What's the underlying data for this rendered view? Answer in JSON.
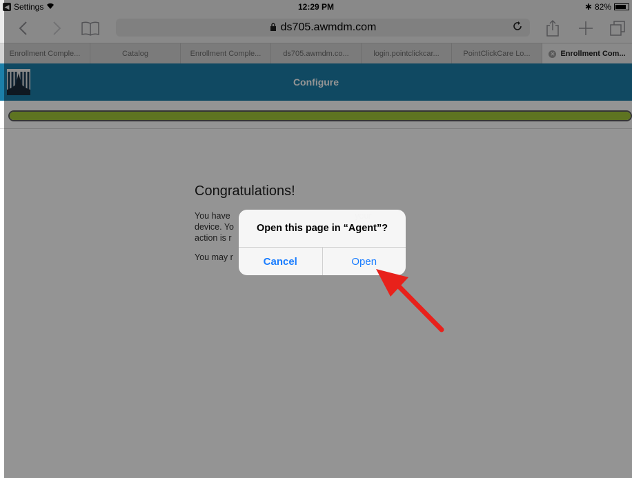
{
  "status_bar": {
    "back_app": "Settings",
    "time": "12:29 PM",
    "bluetooth": "✱",
    "battery_percent": "82%",
    "battery_level": 0.82
  },
  "toolbar": {
    "url": "ds705.awmdm.com"
  },
  "tabs": [
    {
      "label": "Enrollment Comple..."
    },
    {
      "label": "Catalog"
    },
    {
      "label": "Enrollment Comple..."
    },
    {
      "label": "ds705.awmdm.co..."
    },
    {
      "label": "login.pointclickcar..."
    },
    {
      "label": "PointClickCare Lo..."
    },
    {
      "label": "Enrollment Com...",
      "active": true
    }
  ],
  "page": {
    "title": "Configure",
    "progress": 1.0,
    "heading": "Congratulations!",
    "paragraph1": "You have                                                    your\ndevice. Yo                                                 urther\naction is r",
    "paragraph2": "You may r"
  },
  "alert": {
    "message": "Open this page in “Agent”?",
    "cancel_label": "Cancel",
    "open_label": "Open"
  },
  "colors": {
    "header_blue": "#1c7fa9",
    "progress_green": "#a3c93a",
    "ios_blue": "#1a7dff",
    "arrow_red": "#e8211b"
  },
  "icons": {
    "back": "chevron-left-icon",
    "forward": "chevron-right-icon",
    "bookmarks": "book-icon",
    "share": "share-icon",
    "new_tab": "plus-icon",
    "tabs": "tabs-icon",
    "reload": "reload-icon",
    "lock": "lock-icon"
  }
}
